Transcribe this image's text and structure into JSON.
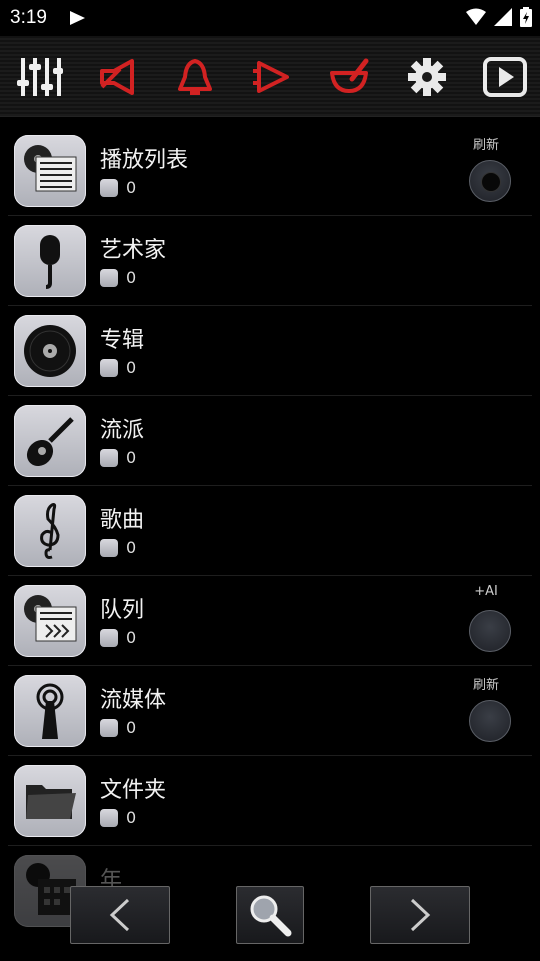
{
  "status": {
    "time": "3:19"
  },
  "toolbar": {
    "icons": [
      "equalizer-icon",
      "speaker-icon",
      "bell-icon",
      "speaker-arrow-icon",
      "mortar-icon",
      "settings-icon",
      "play-icon"
    ]
  },
  "rows": [
    {
      "title": "播放列表",
      "count": "0",
      "icon": "playlist-icon",
      "side_label": "刷新",
      "side_button": "refresh"
    },
    {
      "title": "艺术家",
      "count": "0",
      "icon": "microphone-icon"
    },
    {
      "title": "专辑",
      "count": "0",
      "icon": "disc-icon"
    },
    {
      "title": "流派",
      "count": "0",
      "icon": "guitar-icon"
    },
    {
      "title": "歌曲",
      "count": "0",
      "icon": "treble-clef-icon"
    },
    {
      "title": "队列",
      "count": "0",
      "icon": "queue-icon",
      "side_label": "+AI",
      "side_button": "add"
    },
    {
      "title": "流媒体",
      "count": "0",
      "icon": "antenna-icon",
      "side_label": "刷新",
      "side_button": "refresh"
    },
    {
      "title": "文件夹",
      "count": "0",
      "icon": "folder-icon"
    },
    {
      "title": "年",
      "count": "",
      "icon": "calendar-icon"
    }
  ],
  "bottom_nav": {
    "prev": "chevron-left-icon",
    "search": "search-icon",
    "next": "chevron-right-icon"
  },
  "colors": {
    "accent_red": "#d22222",
    "background": "#000000",
    "tile": "#c4c6cd"
  }
}
